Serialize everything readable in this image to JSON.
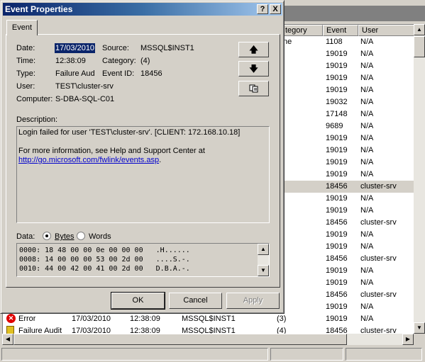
{
  "dialog": {
    "title": "Event Properties",
    "help_label": "?",
    "close_label": "X",
    "tab_label": "Event",
    "fields": {
      "date_label": "Date:",
      "date": "17/03/2010",
      "source_label": "Source:",
      "source": "MSSQL$INST1",
      "time_label": "Time:",
      "time": "12:38:09",
      "category_label": "Category:",
      "category": "(4)",
      "type_label": "Type:",
      "type": "Failure Aud",
      "event_id_label": "Event ID:",
      "event_id": "18456",
      "user_label": "User:",
      "user": "TEST\\cluster-srv",
      "computer_label": "Computer:",
      "computer": "S-DBA-SQL-C01"
    },
    "nav": {
      "up_icon": "arrow-up-icon",
      "down_icon": "arrow-down-icon",
      "copy_icon": "copy-icon"
    },
    "description_label": "Description:",
    "description": {
      "line1": "Login failed for user 'TEST\\cluster-srv'. [CLIENT: 172.168.10.18]",
      "line2": "For more information, see Help and Support Center at",
      "link": "http://go.microsoft.com/fwlink/events.asp",
      "link_suffix": "."
    },
    "data_label": "Data:",
    "bytes_label": "Bytes",
    "words_label": "Words",
    "hex": [
      "0000: 18 48 00 00 0e 00 00 00   .H......",
      "0008: 14 00 00 00 53 00 2d 00   ....S.-.",
      "0010: 44 00 42 00 41 00 2d 00   D.B.A.-."
    ],
    "buttons": {
      "ok": "OK",
      "cancel": "Cancel",
      "apply": "Apply"
    }
  },
  "event_list": {
    "headers": {
      "category": "tegory",
      "event": "Event",
      "user": "User"
    },
    "rows": [
      {
        "category": "ne",
        "event": "1108",
        "user": "N/A"
      },
      {
        "category": "",
        "event": "19019",
        "user": "N/A"
      },
      {
        "category": "",
        "event": "19019",
        "user": "N/A"
      },
      {
        "category": "",
        "event": "19019",
        "user": "N/A"
      },
      {
        "category": "",
        "event": "19019",
        "user": "N/A"
      },
      {
        "category": "",
        "event": "19032",
        "user": "N/A"
      },
      {
        "category": "",
        "event": "17148",
        "user": "N/A"
      },
      {
        "category": "",
        "event": "9689",
        "user": "N/A"
      },
      {
        "category": "",
        "event": "19019",
        "user": "N/A"
      },
      {
        "category": "",
        "event": "19019",
        "user": "N/A"
      },
      {
        "category": "",
        "event": "19019",
        "user": "N/A"
      },
      {
        "category": "",
        "event": "19019",
        "user": "N/A"
      },
      {
        "category": "",
        "event": "18456",
        "user": "cluster-srv"
      },
      {
        "category": "",
        "event": "19019",
        "user": "N/A"
      },
      {
        "category": "",
        "event": "19019",
        "user": "N/A"
      },
      {
        "category": "",
        "event": "18456",
        "user": "cluster-srv"
      },
      {
        "category": "",
        "event": "19019",
        "user": "N/A"
      },
      {
        "category": "",
        "event": "19019",
        "user": "N/A"
      },
      {
        "category": "",
        "event": "18456",
        "user": "cluster-srv"
      },
      {
        "category": "",
        "event": "19019",
        "user": "N/A"
      },
      {
        "category": "",
        "event": "19019",
        "user": "N/A"
      },
      {
        "category": "",
        "event": "18456",
        "user": "cluster-srv"
      },
      {
        "category": "",
        "event": "19019",
        "user": "N/A"
      }
    ],
    "bottom_rows": [
      {
        "type": "Error",
        "date": "17/03/2010",
        "time": "12:38:09",
        "source": "MSSQL$INST1",
        "category": "(3)",
        "event": "19019",
        "user": "N/A"
      },
      {
        "type": "Failure Audit",
        "date": "17/03/2010",
        "time": "12:38:09",
        "source": "MSSQL$INST1",
        "category": "(4)",
        "event": "18456",
        "user": "cluster-srv"
      }
    ]
  }
}
